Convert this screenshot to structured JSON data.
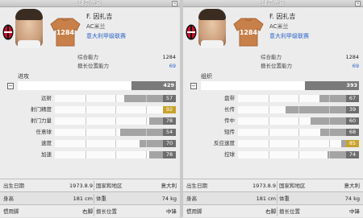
{
  "window_title": "球员信息",
  "panels": [
    {
      "id": "left",
      "player": {
        "name": "F. 因扎吉",
        "club": "AC米兰",
        "league": "意大利甲级联赛",
        "shirt_number": "1284"
      },
      "summary": [
        {
          "label": "综合能力",
          "value": "1284",
          "blue": false
        },
        {
          "label": "擅长位置能力",
          "value": "69",
          "blue": true
        }
      ],
      "category": {
        "label": "进攻",
        "value": "429",
        "fraction": 0.72
      },
      "attributes": [
        {
          "label": "远射",
          "value": "57",
          "fraction": 0.57,
          "gold": false
        },
        {
          "label": "射门精度",
          "value": "92",
          "fraction": 0.92,
          "gold": true
        },
        {
          "label": "射门力量",
          "value": "78",
          "fraction": 0.78,
          "gold": false
        },
        {
          "label": "任意球",
          "value": "54",
          "fraction": 0.54,
          "gold": false
        },
        {
          "label": "速度",
          "value": "70",
          "fraction": 0.7,
          "gold": false
        },
        {
          "label": "加速",
          "value": "78",
          "fraction": 0.78,
          "gold": false
        }
      ],
      "info": [
        {
          "l1": "出生日期",
          "v1": "1973.8.9",
          "l2": "国家和地区",
          "v2": "意大利"
        },
        {
          "l1": "身高",
          "v1": "181 cm",
          "l2": "体重",
          "v2": "74 kg"
        },
        {
          "l1": "惯用脚",
          "v1": "右脚",
          "l2": "擅长位置",
          "v2": "中锋"
        }
      ]
    },
    {
      "id": "right",
      "player": {
        "name": "F. 因扎吉",
        "club": "AC米兰",
        "league": "意大利甲级联赛",
        "shirt_number": "1284"
      },
      "summary": [
        {
          "label": "综合能力",
          "value": "1284",
          "blue": false
        },
        {
          "label": "擅长位置能力",
          "value": "69",
          "blue": true
        }
      ],
      "category": {
        "label": "组织",
        "value": "393",
        "fraction": 0.66
      },
      "attributes": [
        {
          "label": "盘带",
          "value": "67",
          "fraction": 0.67,
          "gold": false
        },
        {
          "label": "长传",
          "value": "39",
          "fraction": 0.39,
          "gold": false
        },
        {
          "label": "传中",
          "value": "60",
          "fraction": 0.6,
          "gold": false
        },
        {
          "label": "短传",
          "value": "68",
          "fraction": 0.68,
          "gold": false
        },
        {
          "label": "反应速度",
          "value": "85",
          "fraction": 0.85,
          "gold": true
        },
        {
          "label": "控球",
          "value": "74",
          "fraction": 0.74,
          "gold": false
        }
      ],
      "info": [
        {
          "l1": "出生日期",
          "v1": "1973.8.9",
          "l2": "国家和地区",
          "v2": "意大利"
        },
        {
          "l1": "身高",
          "v1": "181 cm",
          "l2": "体重",
          "v2": "74 kg"
        },
        {
          "l1": "惯用脚",
          "v1": "右脚",
          "l2": "擅长位置",
          "v2": "中锋"
        }
      ]
    }
  ],
  "colors": {
    "accent_blue": "#2a62c8",
    "gold": "#c8a22a",
    "jersey": "#c8804a"
  },
  "icons": {
    "close": "close-icon",
    "crest": "club-crest-icon",
    "collapse": "minus-icon"
  }
}
